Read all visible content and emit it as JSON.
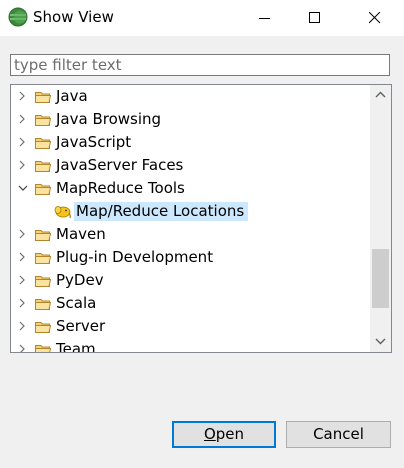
{
  "window": {
    "title": "Show View",
    "app_icon": "eclipse-icon",
    "controls": [
      "minimize-icon",
      "maximize-icon",
      "close-icon"
    ]
  },
  "filter": {
    "value": "",
    "placeholder": "type filter text"
  },
  "tree": {
    "items": [
      {
        "label": "Java",
        "expanded": false,
        "icon": "folder-icon"
      },
      {
        "label": "Java Browsing",
        "expanded": false,
        "icon": "folder-icon"
      },
      {
        "label": "JavaScript",
        "expanded": false,
        "icon": "folder-icon"
      },
      {
        "label": "JavaServer Faces",
        "expanded": false,
        "icon": "folder-icon"
      },
      {
        "label": "MapReduce Tools",
        "expanded": true,
        "icon": "folder-icon",
        "children": [
          {
            "label": "Map/Reduce Locations",
            "selected": true,
            "icon": "elephant-plugin-icon"
          }
        ]
      },
      {
        "label": "Maven",
        "expanded": false,
        "icon": "folder-icon"
      },
      {
        "label": "Plug-in Development",
        "expanded": false,
        "icon": "folder-icon"
      },
      {
        "label": "PyDev",
        "expanded": false,
        "icon": "folder-icon"
      },
      {
        "label": "Scala",
        "expanded": false,
        "icon": "folder-icon"
      },
      {
        "label": "Server",
        "expanded": false,
        "icon": "folder-icon"
      },
      {
        "label": "Team",
        "expanded": false,
        "icon": "folder-icon"
      }
    ]
  },
  "buttons": {
    "open_mnemonic": "O",
    "open_rest": "pen",
    "cancel": "Cancel"
  },
  "colors": {
    "selection": "#cce8ff",
    "default_button_border": "#0078d7",
    "folder_fill": "#f5d27a",
    "folder_stroke": "#b3862b"
  }
}
